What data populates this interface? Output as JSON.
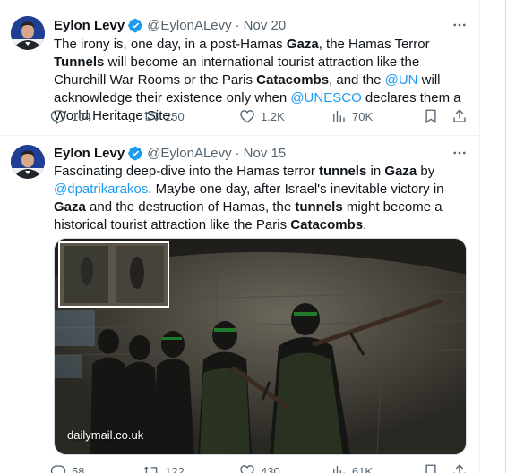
{
  "tweets": [
    {
      "author_name": "Eylon Levy",
      "handle": "@EylonALevy",
      "separator": "·",
      "date": "Nov 20",
      "text_segments": [
        {
          "t": "The irony is, one day, in a post-Hamas ",
          "s": "plain"
        },
        {
          "t": "Gaza",
          "s": "bold"
        },
        {
          "t": ", the Hamas Terror ",
          "s": "plain"
        },
        {
          "t": "Tunnels",
          "s": "bold"
        },
        {
          "t": " will become an international tourist attraction like the Churchill War Rooms or the Paris ",
          "s": "plain"
        },
        {
          "t": "Catacombs",
          "s": "bold"
        },
        {
          "t": ", and the ",
          "s": "plain"
        },
        {
          "t": "@UN",
          "s": "mention"
        },
        {
          "t": " will acknowledge their existence only when ",
          "s": "plain"
        },
        {
          "t": "@UNESCO",
          "s": "mention"
        },
        {
          "t": " declares them a World Heritage Site.",
          "s": "plain"
        }
      ],
      "replies": "104",
      "reposts": "250",
      "likes": "1.2K",
      "views": "70K"
    },
    {
      "author_name": "Eylon Levy",
      "handle": "@EylonALevy",
      "separator": "·",
      "date": "Nov 15",
      "text_segments": [
        {
          "t": "Fascinating deep-dive into the Hamas terror ",
          "s": "plain"
        },
        {
          "t": "tunnels",
          "s": "bold"
        },
        {
          "t": " in ",
          "s": "plain"
        },
        {
          "t": "Gaza",
          "s": "bold"
        },
        {
          "t": " by ",
          "s": "plain"
        },
        {
          "t": "@dpatrikarakos",
          "s": "mention"
        },
        {
          "t": ". Maybe one day, after Israel's inevitable victory in ",
          "s": "plain"
        },
        {
          "t": "Gaza",
          "s": "bold"
        },
        {
          "t": " and the destruction of Hamas, the ",
          "s": "plain"
        },
        {
          "t": "tunnels",
          "s": "bold"
        },
        {
          "t": " might become a historical tourist attraction like the Paris ",
          "s": "plain"
        },
        {
          "t": "Catacombs",
          "s": "bold"
        },
        {
          "t": ".",
          "s": "plain"
        }
      ],
      "media_source": "dailymail.co.uk",
      "replies": "58",
      "reposts": "122",
      "likes": "430",
      "views": "61K"
    }
  ],
  "icons": {
    "verified": "verified-badge-icon",
    "more": "more-options-icon",
    "reply": "reply-icon",
    "repost": "repost-icon",
    "like": "like-icon",
    "views": "views-icon",
    "bookmark": "bookmark-icon",
    "share": "share-icon"
  },
  "colors": {
    "accent": "#1d9bf0",
    "text_primary": "#0f1419",
    "text_secondary": "#536471",
    "divider": "#eff3f4"
  }
}
